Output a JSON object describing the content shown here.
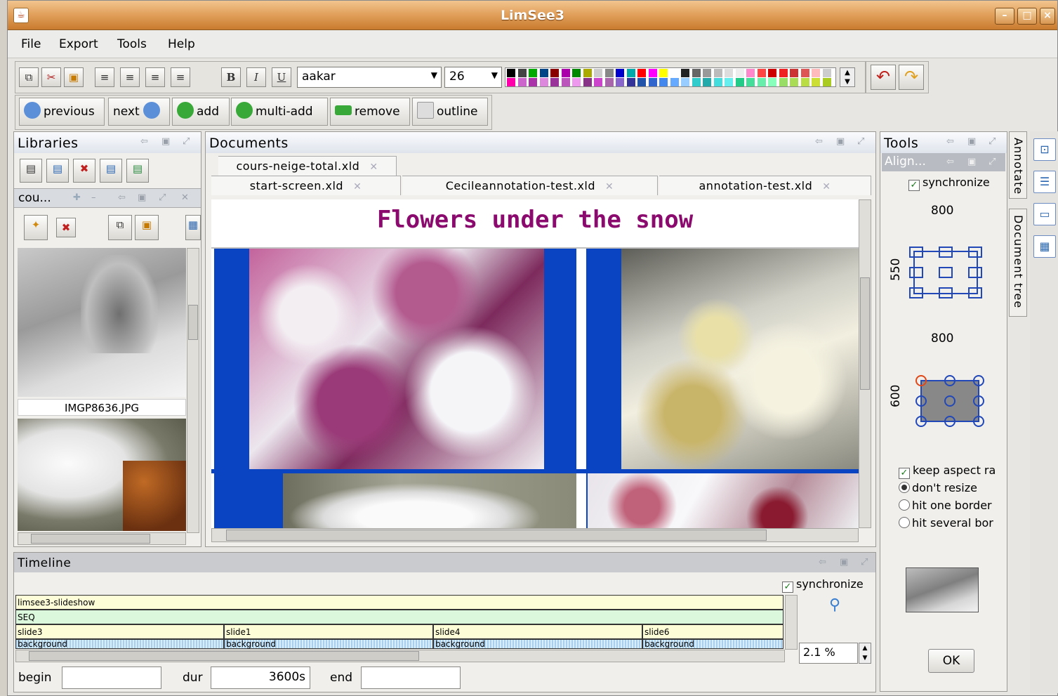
{
  "window": {
    "title": "LimSee3"
  },
  "menu": [
    "File",
    "Export",
    "Tools",
    "Help"
  ],
  "toolbar": {
    "font_family": "aakar",
    "font_size": "26",
    "bold": "B",
    "italic": "I",
    "underline": "U"
  },
  "nav": {
    "previous": "previous",
    "next": "next",
    "add": "add",
    "multi_add": "multi-add",
    "remove": "remove",
    "outline": "outline"
  },
  "libraries": {
    "title": "Libraries",
    "sub_title": "cou...",
    "images": [
      {
        "caption": "IMGP8636.JPG"
      },
      {
        "caption": ""
      }
    ]
  },
  "documents": {
    "title": "Documents",
    "tabs_row1": [
      "cours-neige-total.xld"
    ],
    "tabs_row2": [
      "start-screen.xld",
      "Cecileannotation-test.xld",
      "annotation-test.xld"
    ],
    "slide_title": "Flowers under the snow"
  },
  "tools": {
    "title": "Tools",
    "align": "Align...",
    "synchronize": "synchronize",
    "width1": "800",
    "height1": "550",
    "width2": "800",
    "height2": "600",
    "keep_aspect": "keep aspect ra",
    "dont_resize": "don't resize",
    "hit_one": "hit one border",
    "hit_several": "hit several bor",
    "ok": "OK"
  },
  "side_tabs": [
    "Annotate",
    "Document tree"
  ],
  "timeline": {
    "title": "Timeline",
    "synchronize": "synchronize",
    "root": "limsee3-slideshow",
    "seq": "SEQ",
    "slides": [
      "slide3",
      "slide1",
      "slide4",
      "slide6"
    ],
    "background": "background",
    "zoom": "2.1 %",
    "begin_label": "begin",
    "begin_value": "",
    "dur_label": "dur",
    "dur_value": "3600s",
    "end_label": "end",
    "end_value": ""
  },
  "colors": {
    "title_text": "#8b0a6e",
    "slide_blue": "#0a44c2",
    "titlebar": "#d58c41"
  }
}
